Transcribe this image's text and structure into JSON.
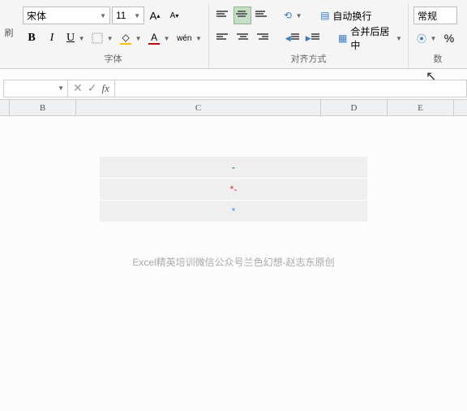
{
  "ribbon": {
    "left_label": "刷",
    "font": {
      "name": "宋体",
      "size": "11",
      "inc": "A",
      "dec": "A",
      "bold": "B",
      "italic": "I",
      "underline": "U",
      "wen": "wén",
      "group_label": "字体"
    },
    "align": {
      "wrap_label": "自动换行",
      "merge_label": "合并后居中",
      "group_label": "对齐方式"
    },
    "number": {
      "format": "常规",
      "percent": "%",
      "group_label": "数"
    }
  },
  "formula_bar": {
    "name_box": "",
    "cancel": "✕",
    "confirm": "✓",
    "fx": "fx",
    "input": ""
  },
  "columns": [
    "B",
    "C",
    "D",
    "E"
  ],
  "cells": {
    "r1": "-",
    "r2": "*-",
    "r3": "*"
  },
  "credit": "Excel精英培训微信公众号兰色幻想-赵志东原创"
}
